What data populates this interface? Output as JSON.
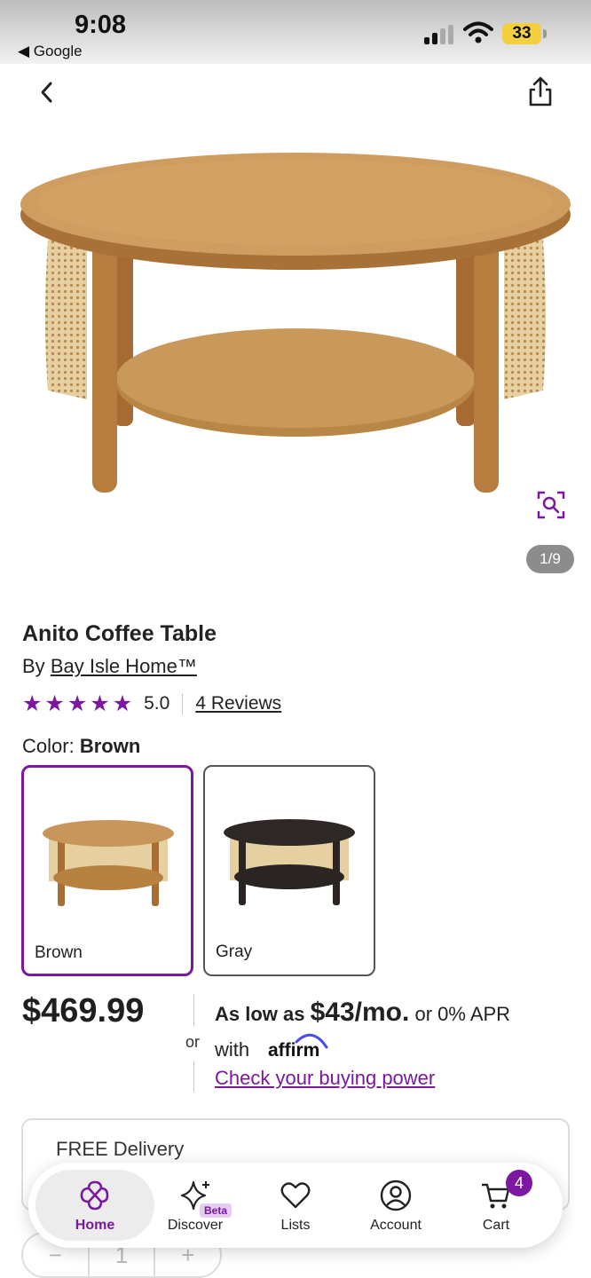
{
  "status_bar": {
    "time": "9:08",
    "back_app": "◀ Google",
    "battery": "33"
  },
  "product": {
    "image_counter": "1/9",
    "title": "Anito Coffee Table",
    "by_prefix": "By",
    "brand": "Bay Isle Home™",
    "rating_value": "5.0",
    "rating_stars": 5,
    "reviews": "4 Reviews",
    "color_label": "Color:",
    "selected_color": "Brown",
    "colors": [
      {
        "name": "Brown",
        "top": "#c8965a",
        "shelf": "#b7823f",
        "legs": "#a86f35",
        "selected": true
      },
      {
        "name": "Gray",
        "top": "#2d2826",
        "shelf": "#2a2523",
        "legs": "#2a2523",
        "selected": false
      }
    ],
    "price": "$469.99",
    "or": "or",
    "financing_prefix": "As low as",
    "financing_amount": "$43/mo.",
    "financing_suffix": "or 0% APR",
    "with": "with",
    "affirm": "affirm",
    "buying_power": "Check your buying power",
    "delivery_label": "FREE Delivery",
    "qty_minus": "−",
    "qty_value": "1",
    "qty_plus": "+"
  },
  "tabbar": {
    "home": "Home",
    "discover": "Discover",
    "discover_badge": "Beta",
    "lists": "Lists",
    "account": "Account",
    "cart": "Cart",
    "cart_count": "4"
  },
  "colors": {
    "accent": "#7b189f",
    "wood": "#c8965a",
    "dark_wood": "#2d2826"
  }
}
